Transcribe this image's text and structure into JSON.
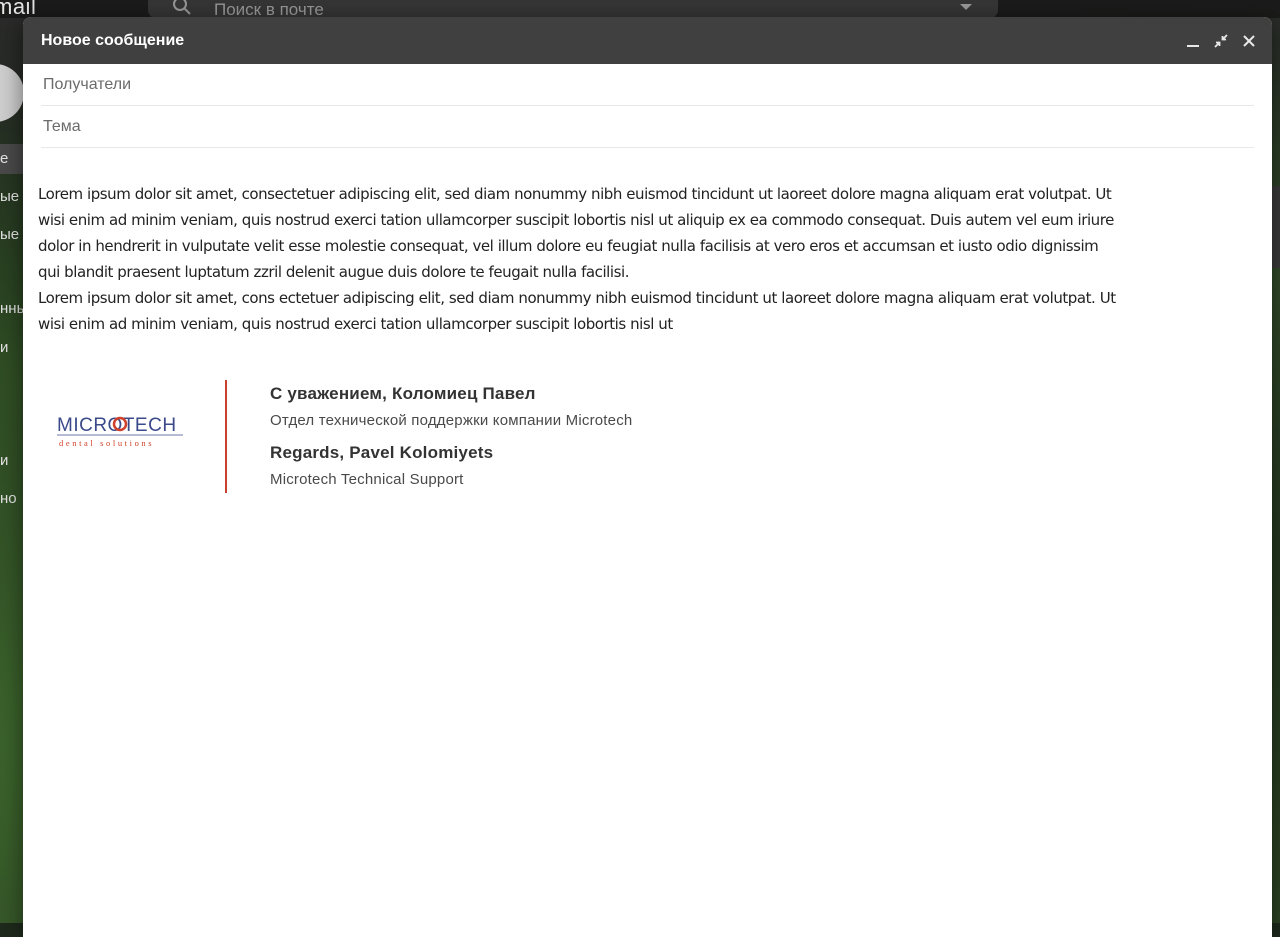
{
  "background": {
    "app_logo_text": "mail",
    "search_placeholder": "Поиск в почте",
    "sidebar_fragments": [
      "е",
      "ые",
      "ые",
      "нны",
      "и",
      "и",
      "но"
    ]
  },
  "compose": {
    "title": "Новое сообщение",
    "recipients_placeholder": "Получатели",
    "subject_placeholder": "Тема",
    "body_paragraphs": [
      "Lorem ipsum dolor sit amet, consectetuer adipiscing elit, sed diam nonummy nibh euismod tincidunt ut laoreet dolore magna aliquam erat volutpat. Ut wisi enim ad minim veniam, quis nostrud exerci tation ullamcorper suscipit lobortis nisl ut aliquip ex ea commodo consequat. Duis autem vel eum iriure dolor in hendrerit in vulputate velit esse molestie consequat, vel illum dolore eu feugiat nulla facilisis at vero eros et accumsan et iusto odio dignissim qui blandit praesent luptatum zzril delenit augue duis dolore te feugait nulla facilisi.",
      "Lorem ipsum dolor sit amet, cons ectetuer adipiscing elit, sed diam nonummy nibh euismod tincidunt ut laoreet dolore magna aliquam erat volutpat. Ut wisi enim ad minim veniam, quis nostrud exerci tation ullamcorper suscipit lobortis nisl ut"
    ],
    "signature": {
      "logo_main": "MICROTECH",
      "logo_tagline": "dental solutions",
      "name_ru": "С уважением, Коломиец Павел",
      "dept_ru": "Отдел технической поддержки компании Microtech",
      "name_en": "Regards, Pavel Kolomiyets",
      "dept_en": "Microtech Technical Support"
    }
  },
  "colors": {
    "header_bg": "#404040",
    "signature_accent": "#c8412c",
    "logo_blue": "#3b4a8a"
  }
}
